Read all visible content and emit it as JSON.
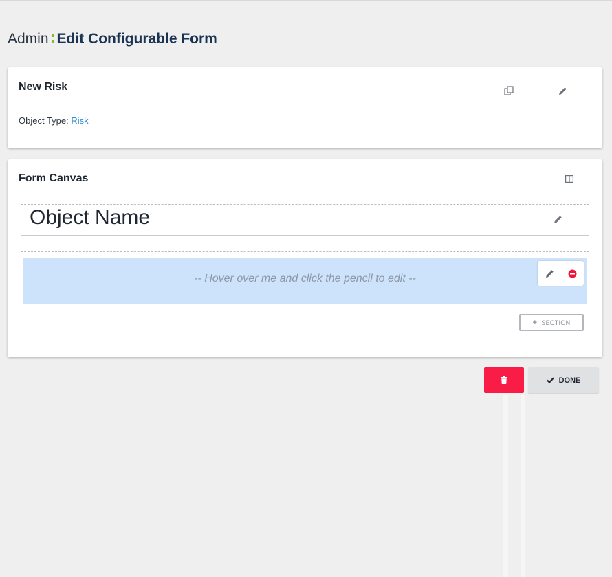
{
  "header": {
    "breadcrumb_root": "Admin",
    "title": "Edit Configurable Form"
  },
  "form_info": {
    "name": "New Risk",
    "object_type_label": "Object Type:",
    "object_type_value": "Risk",
    "icons": [
      "copy-icon",
      "pencil-icon"
    ]
  },
  "form_canvas": {
    "title": "Form Canvas",
    "layout_icon": "columns-icon",
    "object_name_label": "Object Name",
    "section_placeholder": "-- Hover over me and click the pencil to edit --",
    "add_section_label": "SECTION"
  },
  "actions": {
    "done_label": "DONE"
  },
  "colors": {
    "accent_green": "#7bbf26",
    "link_blue": "#2f8fd6",
    "delete_red": "#f81c47",
    "section_highlight": "#cde3fb",
    "title_navy": "#1b3352"
  }
}
